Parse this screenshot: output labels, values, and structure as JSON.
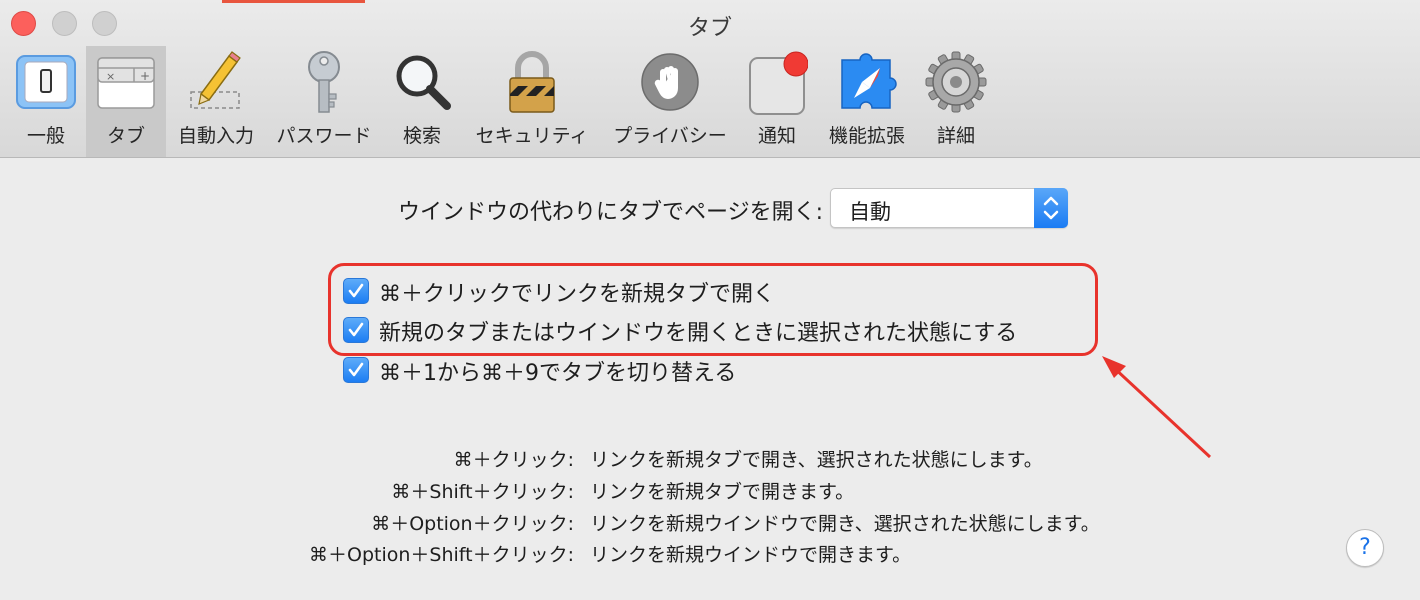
{
  "window": {
    "title": "タブ",
    "accent_color": "#1a7bf3",
    "annotation_color": "#e8332c"
  },
  "toolbar": {
    "tabs": [
      {
        "id": "general",
        "label": "一般",
        "icon": "light-switch-icon",
        "selected": false
      },
      {
        "id": "tabs",
        "label": "タブ",
        "icon": "tabs-icon",
        "selected": true
      },
      {
        "id": "autofill",
        "label": "自動入力",
        "icon": "pencil-icon",
        "selected": false
      },
      {
        "id": "passwords",
        "label": "パスワード",
        "icon": "key-icon",
        "selected": false
      },
      {
        "id": "search",
        "label": "検索",
        "icon": "magnifier-icon",
        "selected": false
      },
      {
        "id": "security",
        "label": "セキュリティ",
        "icon": "padlock-icon",
        "selected": false
      },
      {
        "id": "privacy",
        "label": "プライバシー",
        "icon": "hand-icon",
        "selected": false
      },
      {
        "id": "notifications",
        "label": "通知",
        "icon": "notification-icon",
        "selected": false
      },
      {
        "id": "extensions",
        "label": "機能拡張",
        "icon": "puzzle-compass-icon",
        "selected": false
      },
      {
        "id": "advanced",
        "label": "詳細",
        "icon": "gear-icon",
        "selected": false
      }
    ]
  },
  "open_pages": {
    "label": "ウインドウの代わりにタブでページを開く:",
    "selected_value": "自動"
  },
  "options": [
    {
      "label": "⌘＋クリックでリンクを新規タブで開く",
      "checked": true
    },
    {
      "label": "新規のタブまたはウインドウを開くときに選択された状態にする",
      "checked": true
    },
    {
      "label": "⌘＋1から⌘＋9でタブを切り替える",
      "checked": true
    }
  ],
  "shortcuts": [
    {
      "key": "⌘＋クリック:",
      "description": "リンクを新規タブで開き、選択された状態にします。"
    },
    {
      "key": "⌘＋Shift＋クリック:",
      "description": "リンクを新規タブで開きます。"
    },
    {
      "key": "⌘＋Option＋クリック:",
      "description": "リンクを新規ウインドウで開き、選択された状態にします。"
    },
    {
      "key": "⌘＋Option＋Shift＋クリック:",
      "description": "リンクを新規ウインドウで開きます。"
    }
  ],
  "help": {
    "label": "?"
  }
}
